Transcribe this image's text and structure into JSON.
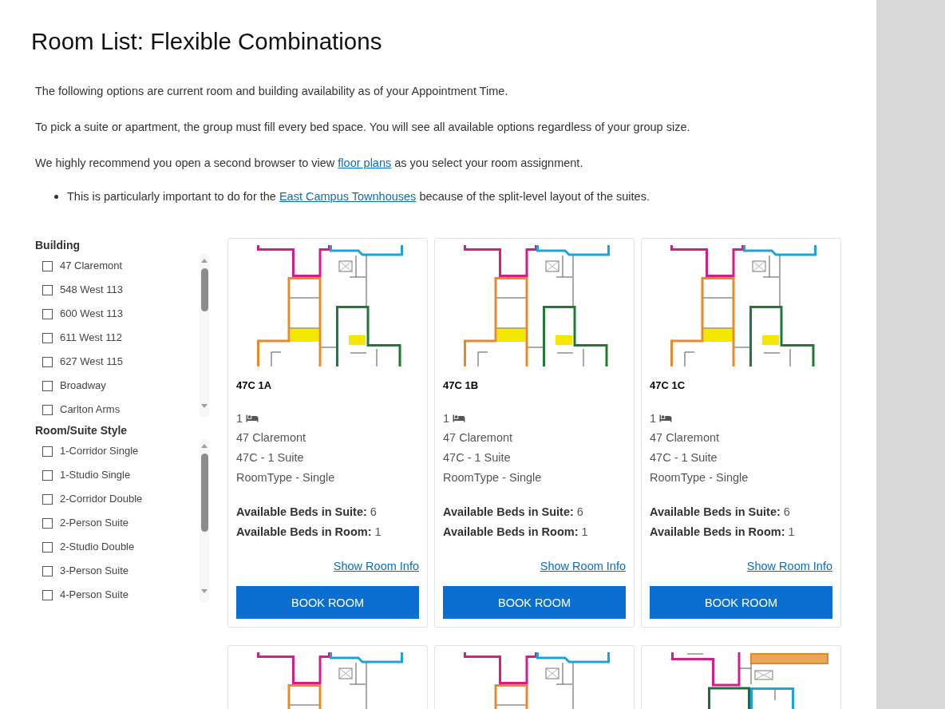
{
  "page": {
    "title": "Room List: Flexible Combinations"
  },
  "intro": {
    "paragraphs": [
      {
        "segments": [
          {
            "kind": "text",
            "text": "The following options are current room and building availability as of your Appointment Time."
          }
        ]
      },
      {
        "segments": [
          {
            "kind": "text",
            "text": "To pick a suite or apartment, the group must fill every bed space. You will see all available options regardless of your group size."
          }
        ]
      },
      {
        "segments": [
          {
            "kind": "text",
            "text": "We highly recommend you open a second browser to view "
          },
          {
            "kind": "link",
            "text": "floor plans"
          },
          {
            "kind": "text",
            "text": " as you select your room assignment."
          }
        ]
      }
    ],
    "bullets": [
      {
        "segments": [
          {
            "kind": "text",
            "text": "This is particularly important to do for the "
          },
          {
            "kind": "link",
            "text": "East Campus Townhouses"
          },
          {
            "kind": "text",
            "text": " because of the split-level layout of the suites."
          }
        ]
      }
    ]
  },
  "filters": [
    {
      "heading": "Building",
      "options": [
        {
          "label": "47 Claremont",
          "checked": false
        },
        {
          "label": "548 West 113",
          "checked": false
        },
        {
          "label": "600 West 113",
          "checked": false
        },
        {
          "label": "611 West 112",
          "checked": false
        },
        {
          "label": "627 West 115",
          "checked": false
        },
        {
          "label": "Broadway",
          "checked": false
        },
        {
          "label": "Carlton Arms",
          "checked": false
        }
      ]
    },
    {
      "heading": "Room/Suite Style",
      "options": [
        {
          "label": "1-Corridor Single",
          "checked": false
        },
        {
          "label": "1-Studio Single",
          "checked": false
        },
        {
          "label": "2-Corridor Double",
          "checked": false
        },
        {
          "label": "2-Person Suite",
          "checked": false
        },
        {
          "label": "2-Studio Double",
          "checked": false
        },
        {
          "label": "3-Person Suite",
          "checked": false
        },
        {
          "label": "4-Person Suite",
          "checked": false
        }
      ]
    }
  ],
  "cards": [
    {
      "kind": "linear",
      "title": "47C 1A",
      "beds": "1",
      "building": "47 Claremont",
      "suite": "47C - 1 Suite",
      "room_type": "RoomType - Single",
      "stats": [
        "**Available Beds in Suite:** 6",
        "**Available Beds in Room:** 1"
      ],
      "link": "Show Room Info",
      "button": "BOOK ROOM"
    },
    {
      "kind": "linear",
      "title": "47C 1B",
      "beds": "1",
      "building": "47 Claremont",
      "suite": "47C - 1 Suite",
      "room_type": "RoomType - Single",
      "stats": [
        "**Available Beds in Suite:** 6",
        "**Available Beds in Room:** 1"
      ],
      "link": "Show Room Info",
      "button": "BOOK ROOM"
    },
    {
      "kind": "linear",
      "title": "47C 1C",
      "beds": "1",
      "building": "47 Claremont",
      "suite": "47C - 1 Suite",
      "room_type": "RoomType - Single",
      "stats": [
        "**Available Beds in Suite:** 6",
        "**Available Beds in Room:** 1"
      ],
      "link": "Show Room Info",
      "button": "BOOK ROOM"
    },
    {
      "kind": "linear"
    },
    {
      "kind": "linear"
    },
    {
      "kind": "cluster"
    }
  ]
}
